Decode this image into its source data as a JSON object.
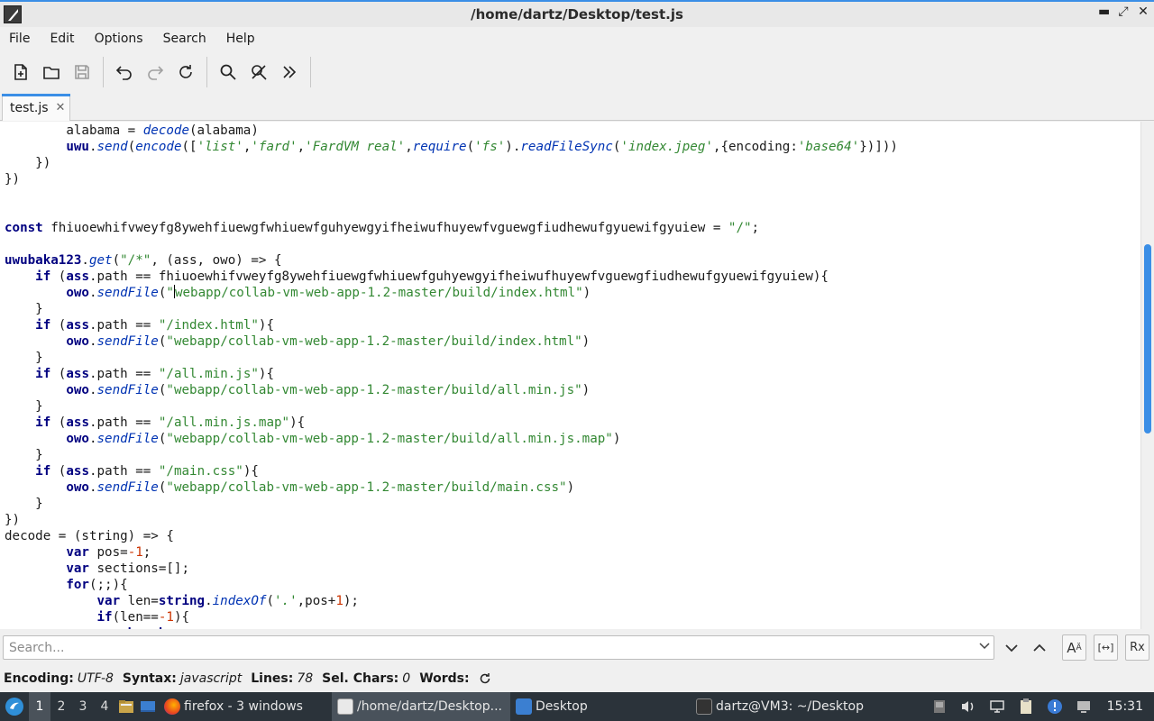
{
  "window": {
    "title": "/home/dartz/Desktop/test.js",
    "controls": {
      "minimize": "▬",
      "restore": "⤢",
      "close": "✕"
    }
  },
  "menubar": {
    "items": [
      "File",
      "Edit",
      "Options",
      "Search",
      "Help"
    ]
  },
  "toolbar": {
    "buttons": [
      "new-file-icon",
      "open-folder-icon",
      "save-icon",
      "undo-icon",
      "redo-icon",
      "reload-icon",
      "search-icon",
      "replace-icon",
      "more-icon"
    ]
  },
  "tabs": [
    {
      "label": "test.js",
      "close": "✕"
    }
  ],
  "editor": {
    "lines": [
      "        alabama = decode(alabama)",
      "        uwu.send(encode(['list','fard','FardVM real',require('fs').readFileSync('index.jpeg',{encoding:'base64'})]))",
      "    })",
      "})",
      "",
      "",
      "const fhiuoewhifvweyfg8ywehfiuewgfwhiuewfguhyewgyifheiwufhuyewfvguewgfiudhewufgyuewifgyuiew = \"/\";",
      "",
      "uwubaka123.get(\"/*\", (ass, owo) => {",
      "    if (ass.path == fhiuoewhifvweyfg8ywehfiuewgfwhiuewfguhyewgyifheiwufhuyewfvguewgfiudhewufgyuewifgyuiew){",
      "        owo.sendFile(\"webapp/collab-vm-web-app-1.2-master/build/index.html\")",
      "    }",
      "    if (ass.path == \"/index.html\"){",
      "        owo.sendFile(\"webapp/collab-vm-web-app-1.2-master/build/index.html\")",
      "    }",
      "    if (ass.path == \"/all.min.js\"){",
      "        owo.sendFile(\"webapp/collab-vm-web-app-1.2-master/build/all.min.js\")",
      "    }",
      "    if (ass.path == \"/all.min.js.map\"){",
      "        owo.sendFile(\"webapp/collab-vm-web-app-1.2-master/build/all.min.js.map\")",
      "    }",
      "    if (ass.path == \"/main.css\"){",
      "        owo.sendFile(\"webapp/collab-vm-web-app-1.2-master/build/main.css\")",
      "    }",
      "})",
      "decode = (string) => {",
      "        var pos=-1;",
      "        var sections=[];",
      "        for(;;){",
      "            var len=string.indexOf('.',pos+1);",
      "            if(len==-1){",
      "                break;"
    ]
  },
  "search": {
    "placeholder": "Search...",
    "value": "",
    "dropdown_icon": "chevron-down-icon",
    "next_icon": "chevron-down-icon",
    "prev_icon": "chevron-up-icon",
    "case_label": "A",
    "whole_word_label": "[↔]",
    "regex_label": "Rx"
  },
  "status": {
    "encoding_label": "Encoding:",
    "encoding": "UTF-8",
    "syntax_label": "Syntax:",
    "syntax": "javascript",
    "lines_label": "Lines:",
    "lines": "78",
    "selchars_label": "Sel. Chars:",
    "selchars": "0",
    "words_label": "Words:"
  },
  "taskbar": {
    "workspaces": [
      "1",
      "2",
      "3",
      "4"
    ],
    "active_workspace": "1",
    "tasks": [
      {
        "label": "firefox - 3 windows",
        "icon": "firefox-icon"
      },
      {
        "label": "/home/dartz/Desktop...",
        "icon": "editor-icon"
      },
      {
        "label": "Desktop",
        "icon": "folder-icon"
      },
      {
        "label": "dartz@VM3: ~/Desktop",
        "icon": "terminal-icon"
      }
    ],
    "clock": "15:31"
  },
  "colors": {
    "accent": "#3a8ee6",
    "taskbar": "#2b333a",
    "string": "#338833",
    "keyword": "#000080"
  }
}
